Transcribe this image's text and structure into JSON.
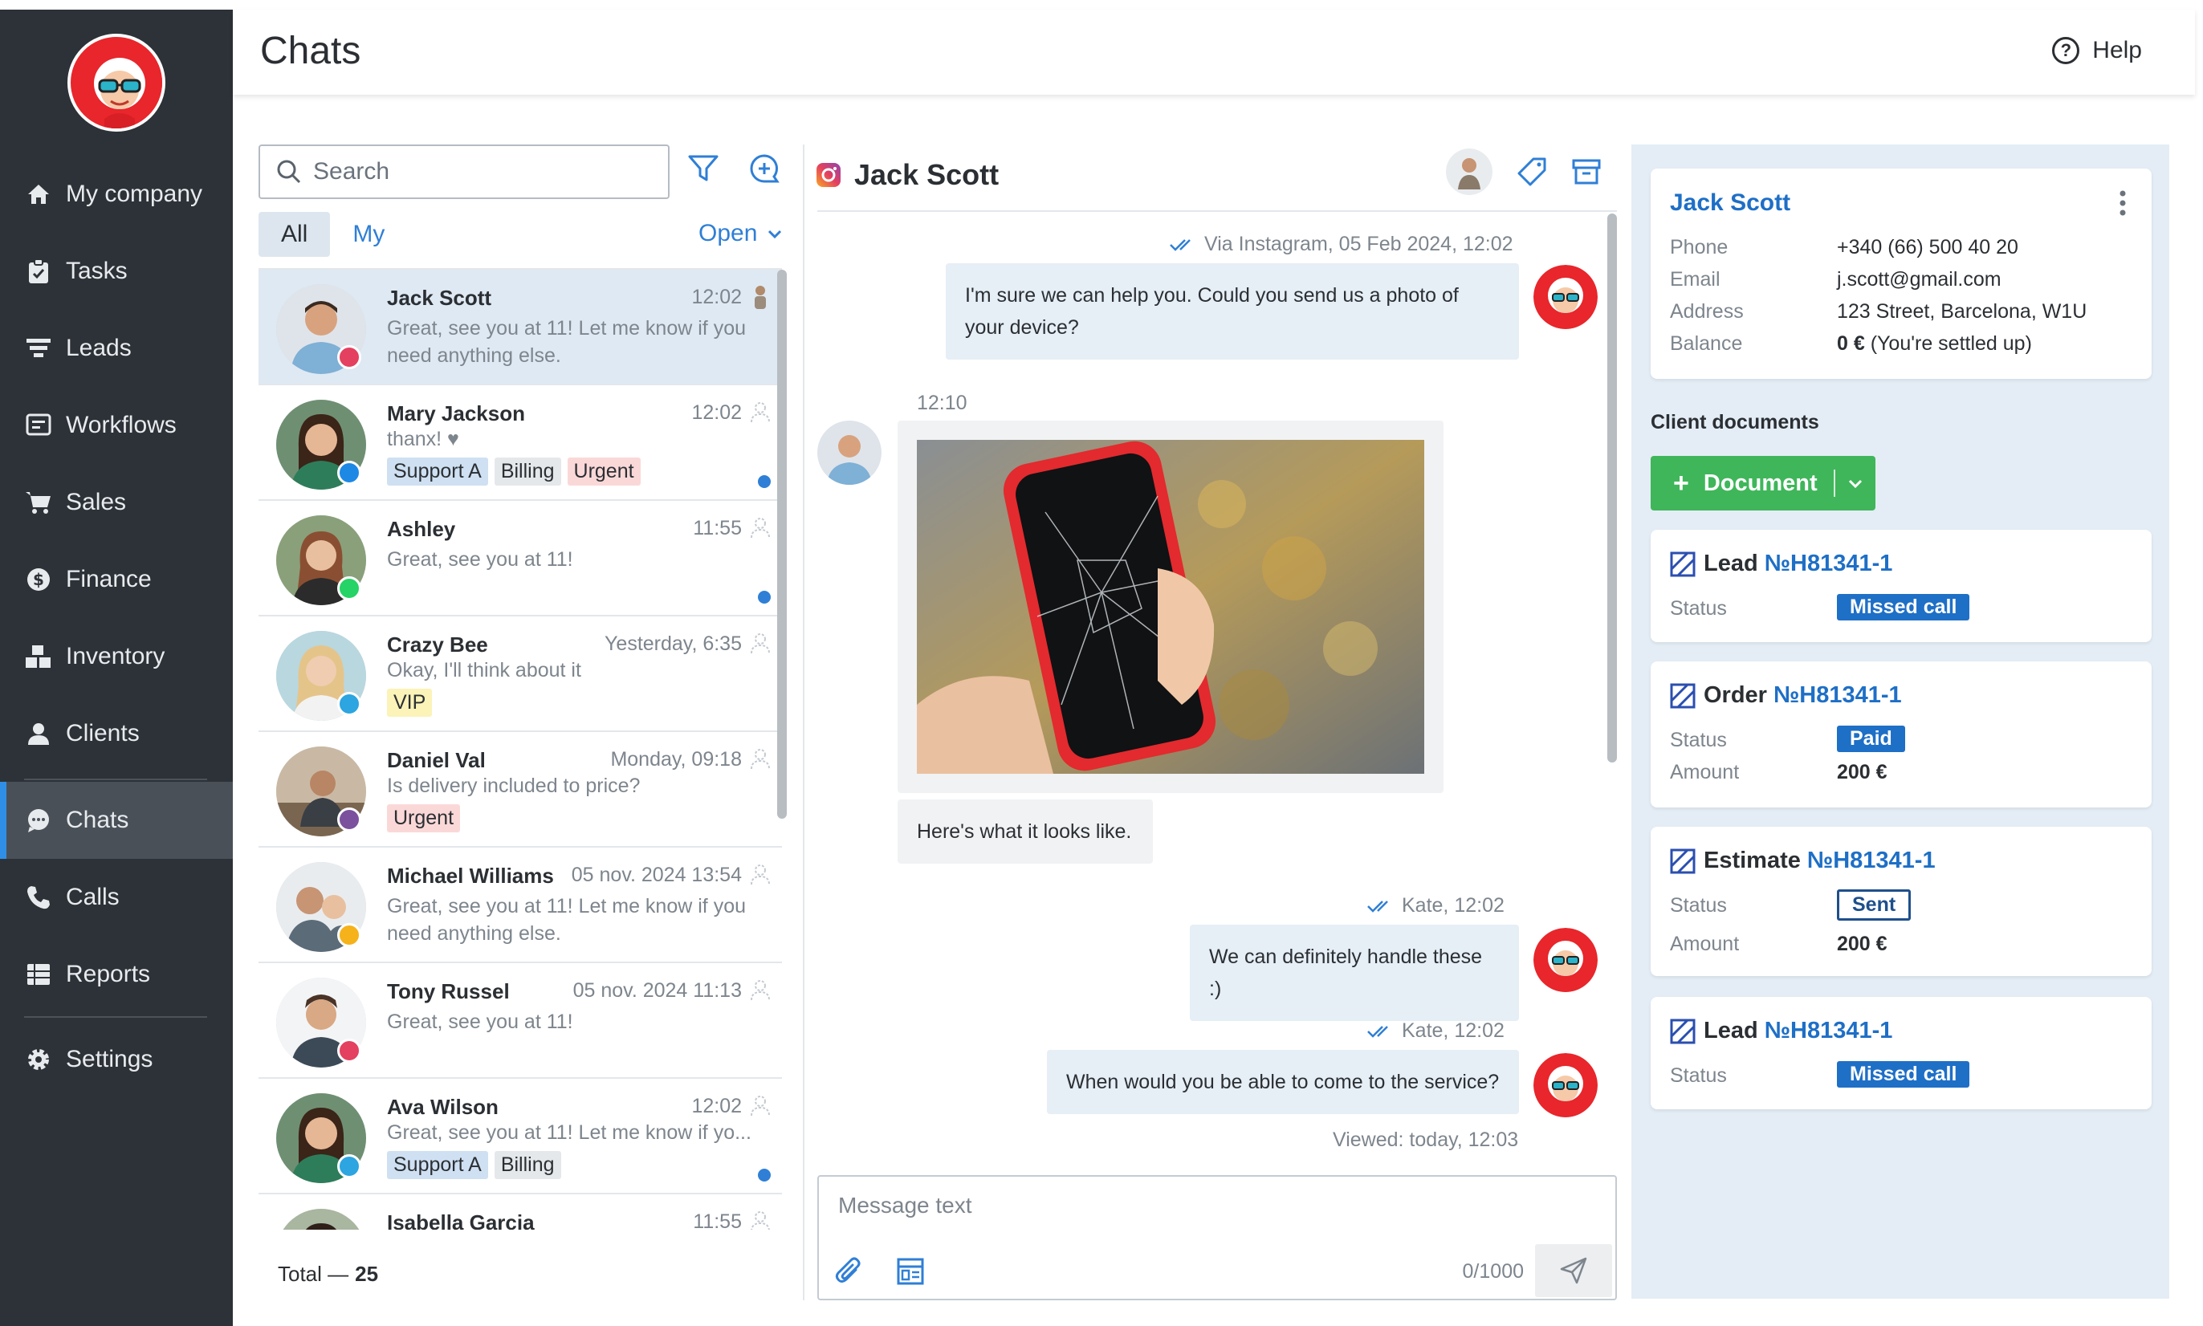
{
  "app": {
    "title": "Chats",
    "help_label": "Help"
  },
  "sidebar": {
    "items": [
      {
        "label": "My company",
        "icon": "home-icon"
      },
      {
        "label": "Tasks",
        "icon": "clipboard-icon"
      },
      {
        "label": "Leads",
        "icon": "funnel-icon"
      },
      {
        "label": "Workflows",
        "icon": "workflow-icon"
      },
      {
        "label": "Sales",
        "icon": "cart-icon"
      },
      {
        "label": "Finance",
        "icon": "dollar-icon"
      },
      {
        "label": "Inventory",
        "icon": "boxes-icon"
      },
      {
        "label": "Clients",
        "icon": "user-icon"
      },
      {
        "label": "Chats",
        "icon": "chat-icon",
        "active": true
      },
      {
        "label": "Calls",
        "icon": "phone-icon"
      },
      {
        "label": "Reports",
        "icon": "reports-icon"
      },
      {
        "label": "Settings",
        "icon": "gear-icon"
      }
    ]
  },
  "chat_list": {
    "search_placeholder": "Search",
    "tabs": [
      "All",
      "My"
    ],
    "active_tab": "All",
    "status_filter": "Open",
    "total_label": "Total —",
    "total_count": "25",
    "rows": [
      {
        "name": "Jack Scott",
        "time": "12:02",
        "preview": "Great, see you at 11! Let me know if you need anything else.",
        "channel": "instagram",
        "tags": [],
        "unread": false,
        "selected": true
      },
      {
        "name": "Mary Jackson",
        "time": "12:02",
        "preview": "thanx! ♥",
        "channel": "messenger",
        "tags": [
          {
            "label": "Support A",
            "color": "blue"
          },
          {
            "label": "Billing",
            "color": "gray"
          },
          {
            "label": "Urgent",
            "color": "red"
          }
        ],
        "unread": true
      },
      {
        "name": "Ashley",
        "time": "11:55",
        "preview": "Great, see you at 11!",
        "channel": "whatsapp",
        "tags": [],
        "unread": true
      },
      {
        "name": "Crazy Bee",
        "time": "Yesterday, 6:35",
        "preview": "Okay, I'll think about it",
        "channel": "telegram",
        "tags": [
          {
            "label": "VIP",
            "color": "yellow"
          }
        ],
        "unread": false
      },
      {
        "name": "Daniel Val",
        "time": "Monday, 09:18",
        "preview": "Is delivery included to price?",
        "channel": "viber",
        "tags": [
          {
            "label": "Urgent",
            "color": "red"
          }
        ],
        "unread": false
      },
      {
        "name": "Michael Williams",
        "time": "05 nov. 2024 13:54",
        "preview": "Great, see you at 11! Let me know if you need anything else.",
        "channel": "widget",
        "tags": [],
        "unread": false
      },
      {
        "name": "Tony Russel",
        "time": "05 nov. 2024 11:13",
        "preview": "Great, see you at 11!",
        "channel": "instagram",
        "tags": [],
        "unread": false
      },
      {
        "name": "Ava Wilson",
        "time": "12:02",
        "preview": "Great, see you at 11! Let me know if yo...",
        "channel": "telegram",
        "tags": [
          {
            "label": "Support A",
            "color": "blue"
          },
          {
            "label": "Billing",
            "color": "gray"
          }
        ],
        "unread": true
      },
      {
        "name": "Isabella Garcia",
        "time": "11:55",
        "preview": "",
        "channel": "whatsapp",
        "tags": [],
        "unread": false
      }
    ]
  },
  "conversation": {
    "contact_name": "Jack Scott",
    "messages": {
      "m1_meta": "Via Instagram, 05 Feb 2024, 12:02",
      "m1_text": "I'm sure we can help you. Could you send us a photo of your device?",
      "m2_meta": "12:10",
      "m2_caption": "Here's what it looks like.",
      "m3_meta": "Kate, 12:02",
      "m3_text": "We can definitely handle these :)",
      "m4_meta": "Kate, 12:02",
      "m4_text": "When would you be able to come to the service?",
      "viewed": "Viewed: today, 12:03"
    },
    "composer": {
      "placeholder": "Message text",
      "counter": "0/1000"
    }
  },
  "client": {
    "name": "Jack Scott",
    "fields": [
      {
        "key": "Phone",
        "value": "+340 (66) 500 40 20"
      },
      {
        "key": "Email",
        "value": "j.scott@gmail.com"
      },
      {
        "key": "Address",
        "value": "123 Street, Barcelona, W1U"
      },
      {
        "key": "Balance",
        "value_bold": "0 €",
        "value": " (You're settled up)"
      }
    ],
    "documents_title": "Client documents",
    "document_button": "Document",
    "documents": [
      {
        "type": "Lead",
        "number": "№H81341-1",
        "status_label": "Status",
        "status": "Missed call",
        "status_style": "blue"
      },
      {
        "type": "Order",
        "number": "№H81341-1",
        "status_label": "Status",
        "status": "Paid",
        "status_style": "blue",
        "amount_label": "Amount",
        "amount": "200 €"
      },
      {
        "type": "Estimate",
        "number": "№H81341-1",
        "status_label": "Status",
        "status": "Sent",
        "status_style": "outline",
        "amount_label": "Amount",
        "amount": "200 €"
      },
      {
        "type": "Lead",
        "number": "№H81341-1",
        "status_label": "Status",
        "status": "Missed call",
        "status_style": "blue"
      }
    ]
  },
  "colors": {
    "sidebar_bg": "#2d3238",
    "accent": "#2f7fd6",
    "link": "#1e6fc6",
    "success": "#3fb65a",
    "panel_bg": "#e4edf5"
  }
}
